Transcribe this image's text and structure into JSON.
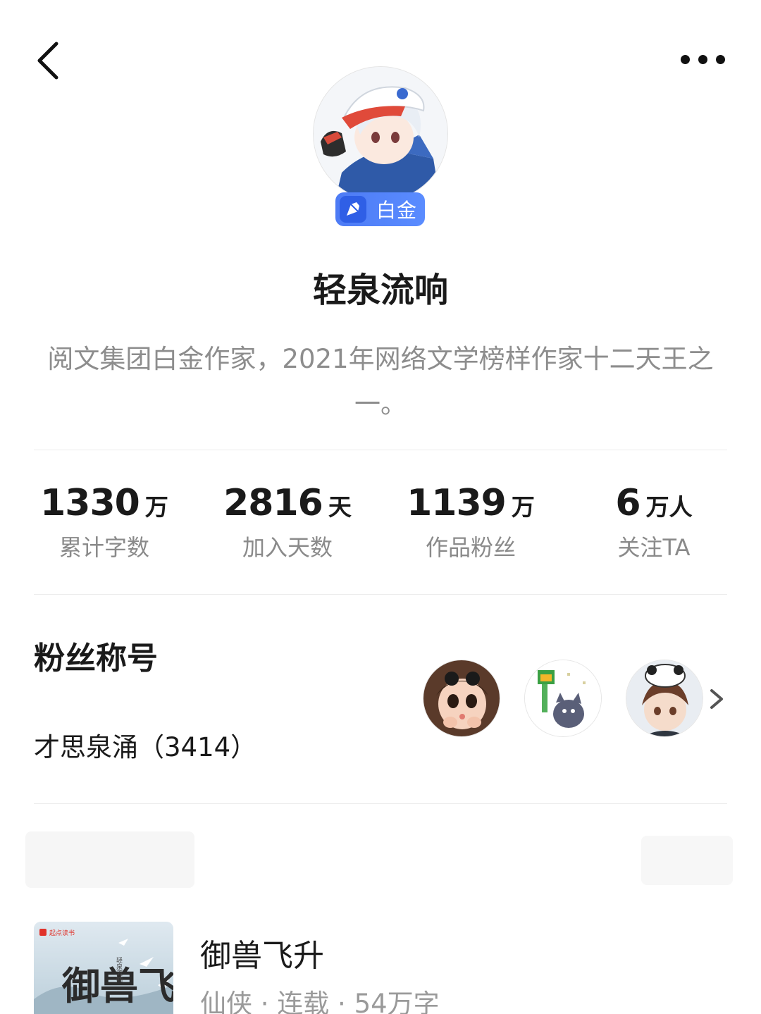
{
  "nav": {
    "back_icon": "chevron-left-icon",
    "more_icon": "more-dots-icon"
  },
  "profile": {
    "badge": "白金",
    "name": "轻泉流响",
    "bio": "阅文集团白金作家，2021年网络文学榜样作家十二天王之一。",
    "accent_color": "#4d7bf5"
  },
  "stats": [
    {
      "value": "1330",
      "unit": "万",
      "label": "累计字数"
    },
    {
      "value": "2816",
      "unit": "天",
      "label": "加入天数"
    },
    {
      "value": "1139",
      "unit": "万",
      "label": "作品粉丝"
    },
    {
      "value": "6",
      "unit": "万人",
      "label": "关注TA"
    }
  ],
  "fans": {
    "title": "粉丝称号",
    "name": "才思泉涌（3414）"
  },
  "book": {
    "title": "御兽飞升",
    "meta": "仙侠 · 连载 · 54万字",
    "cover_text": "御兽飞",
    "cover_brand": "起点读书",
    "cover_author": "轻泉流响"
  }
}
